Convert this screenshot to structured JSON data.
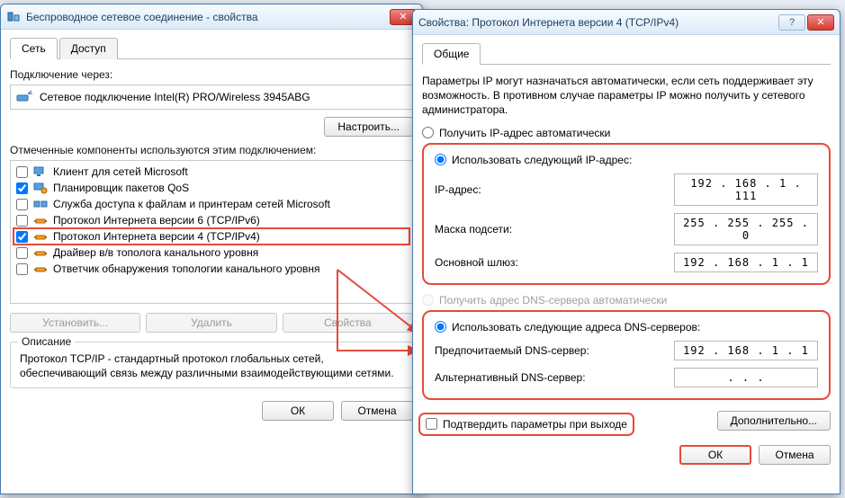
{
  "back_window": {
    "title": "Беспроводное сетевое соединение - свойства",
    "tabs": {
      "network": "Сеть",
      "access": "Доступ"
    },
    "connect_via_label": "Подключение через:",
    "adapter": "Сетевое подключение Intel(R) PRO/Wireless 3945ABG",
    "configure_btn": "Настроить...",
    "components_label": "Отмеченные компоненты используются этим подключением:",
    "components": [
      {
        "label": "Клиент для сетей Microsoft",
        "checked": false,
        "icon": "client"
      },
      {
        "label": "Планировщик пакетов QoS",
        "checked": true,
        "icon": "qos"
      },
      {
        "label": "Служба доступа к файлам и принтерам сетей Microsoft",
        "checked": false,
        "icon": "share"
      },
      {
        "label": "Протокол Интернета версии 6 (TCP/IPv6)",
        "checked": false,
        "icon": "proto"
      },
      {
        "label": "Протокол Интернета версии 4 (TCP/IPv4)",
        "checked": true,
        "icon": "proto",
        "highlight": true
      },
      {
        "label": "Драйвер в/в тополога канального уровня",
        "checked": false,
        "icon": "proto"
      },
      {
        "label": "Ответчик обнаружения топологии канального уровня",
        "checked": false,
        "icon": "proto"
      }
    ],
    "install_btn": "Установить...",
    "uninstall_btn": "Удалить",
    "properties_btn": "Свойства",
    "description_legend": "Описание",
    "description_text": "Протокол TCP/IP - стандартный протокол глобальных сетей, обеспечивающий связь между различными взаимодействующими сетями.",
    "ok_btn": "ОК",
    "cancel_btn": "Отмена"
  },
  "front_window": {
    "title": "Свойства: Протокол Интернета версии 4 (TCP/IPv4)",
    "help_icon": "?",
    "tab_general": "Общие",
    "info_text": "Параметры IP могут назначаться автоматически, если сеть поддерживает эту возможность. В противном случае параметры IP можно получить у сетевого администратора.",
    "ip_auto": "Получить IP-адрес автоматически",
    "ip_manual": "Использовать следующий IP-адрес:",
    "ip_label": "IP-адрес:",
    "ip_value": "192 . 168 .   1 . 111",
    "mask_label": "Маска подсети:",
    "mask_value": "255 . 255 . 255 .   0",
    "gateway_label": "Основной шлюз:",
    "gateway_value": "192 . 168 .   1 .   1",
    "dns_auto": "Получить адрес DNS-сервера автоматически",
    "dns_manual": "Использовать следующие адреса DNS-серверов:",
    "dns_pref_label": "Предпочитаемый DNS-сервер:",
    "dns_pref_value": "192 . 168 .   1 .   1",
    "dns_alt_label": "Альтернативный DNS-сервер:",
    "dns_alt_value": " .       .       .",
    "validate_label": "Подтвердить параметры при выходе",
    "advanced_btn": "Дополнительно...",
    "ok_btn": "ОК",
    "cancel_btn": "Отмена"
  }
}
